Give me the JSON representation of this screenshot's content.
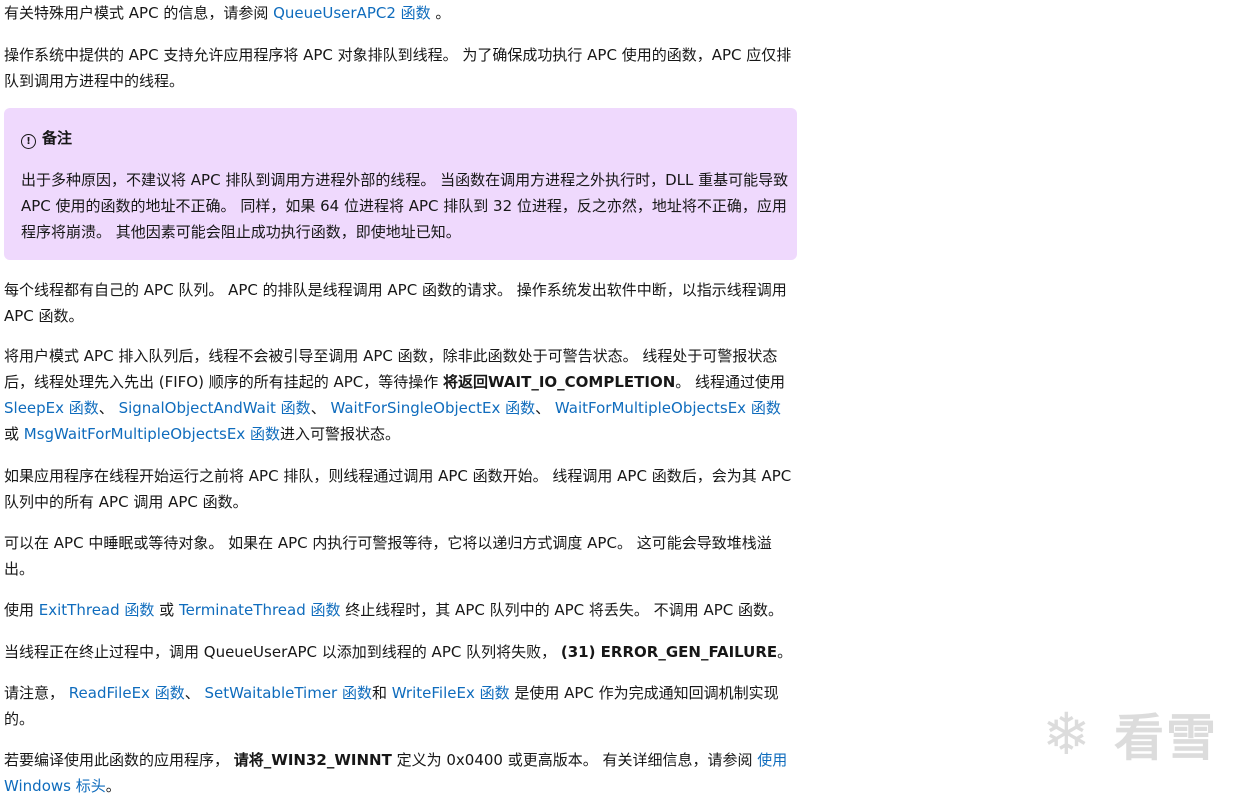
{
  "p1": {
    "t1": "有关特殊用户模式 APC 的信息，请参阅 ",
    "link1": "QueueUserAPC2 函数",
    "t2": " 。"
  },
  "p2": {
    "text": "操作系统中提供的 APC 支持允许应用程序将 APC 对象排队到线程。 为了确保成功执行 APC 使用的函数，APC 应仅排队到调用方进程中的线程。"
  },
  "note": {
    "icon": "info-circle-icon",
    "title": "备注",
    "body": "出于多种原因，不建议将 APC 排队到调用方进程外部的线程。 当函数在调用方进程之外执行时，DLL 重基可能导致 APC 使用的函数的地址不正确。 同样，如果 64 位进程将 APC 排队到 32 位进程，反之亦然，地址将不正确，应用程序将崩溃。 其他因素可能会阻止成功执行函数，即使地址已知。"
  },
  "p3": {
    "text": "每个线程都有自己的 APC 队列。 APC 的排队是线程调用 APC 函数的请求。 操作系统发出软件中断，以指示线程调用 APC 函数。"
  },
  "p4": {
    "t1": "将用户模式 APC 排入队列后，线程不会被引导至调用 APC 函数，除非此函数处于可警告状态。 线程处于可警报状态后，线程处理先入先出 (FIFO) 顺序的所有挂起的 APC，等待操作 ",
    "bold1": "将返回WAIT_IO_COMPLETION",
    "t2": "。 线程通过使用 ",
    "link1": "SleepEx 函数",
    "t3": "、 ",
    "link2": "SignalObjectAndWait 函数",
    "t4": "、 ",
    "link3": "WaitForSingleObjectEx 函数",
    "t5": "、 ",
    "link4": "WaitForMultipleObjectsEx 函数",
    "t6": " 或 ",
    "link5": "MsgWaitForMultipleObjectsEx 函数",
    "t7": "进入可警报状态。"
  },
  "p5": {
    "text": "如果应用程序在线程开始运行之前将 APC 排队，则线程通过调用 APC 函数开始。 线程调用 APC 函数后，会为其 APC 队列中的所有 APC 调用 APC 函数。"
  },
  "p6": {
    "text": "可以在 APC 中睡眠或等待对象。 如果在 APC 内执行可警报等待，它将以递归方式调度 APC。 这可能会导致堆栈溢出。"
  },
  "p7": {
    "t1": "使用 ",
    "link1": "ExitThread 函数",
    "t2": " 或 ",
    "link2": "TerminateThread 函数",
    "t3": " 终止线程时，其 APC 队列中的 APC 将丢失。 不调用 APC 函数。"
  },
  "p8": {
    "t1": "当线程正在终止过程中，调用 QueueUserAPC 以添加到线程的 APC 队列将失败， ",
    "bold1": "(31) ERROR_GEN_FAILURE",
    "t2": "。"
  },
  "p9": {
    "t1": "请注意， ",
    "link1": "ReadFileEx 函数",
    "t2": "、 ",
    "link2": "SetWaitableTimer 函数",
    "t3": "和 ",
    "link3": "WriteFileEx 函数",
    "t4": " 是使用 APC 作为完成通知回调机制实现的。"
  },
  "p10": {
    "t1": "若要编译使用此函数的应用程序， ",
    "bold1": "请将_WIN32_WINNT",
    "t2": " 定义为 0x0400 或更高版本。 有关详细信息，请参阅 ",
    "link1": "使用 Windows 标头",
    "t3": "。"
  },
  "watermark": {
    "icon": "snowflake-icon",
    "text": "看雪"
  }
}
